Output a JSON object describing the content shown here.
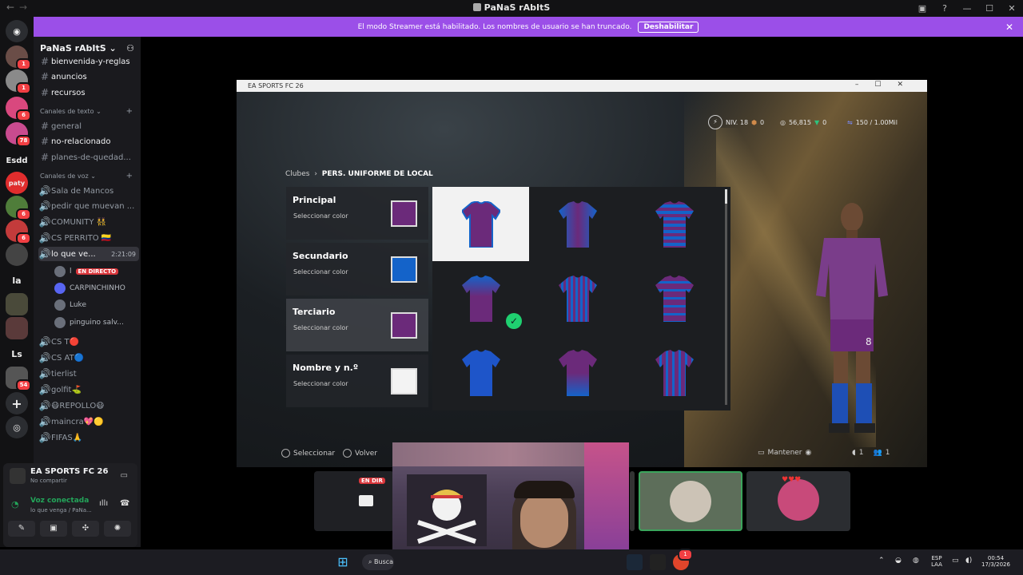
{
  "window": {
    "title": "PaNaS rAbItS"
  },
  "streamer_banner": {
    "message": "El modo Streamer está habilitado. Los nombres de usuario se han truncado.",
    "button": "Deshabilitar"
  },
  "rail": {
    "labels": {
      "esdd": "Esdd",
      "la": "la",
      "ls": "Ls",
      "paty": "paty"
    },
    "badges": [
      "1",
      "1",
      "6",
      "78",
      "6",
      "6",
      "54"
    ]
  },
  "sidebar": {
    "guild_name": "PaNaS rAbItS",
    "top_channels": [
      "bienvenida-y-reglas",
      "anuncios",
      "recursos"
    ],
    "text_category": "Canales de texto",
    "text_channels": [
      "general",
      "no-relacionado",
      "planes-de-quedad..."
    ],
    "voice_category": "Canales de voz",
    "voice_channels": [
      "Sala de Mancos",
      "pedir que muevan ...",
      "COMUNITY 👯",
      "CS PERRITO 🇨🇴",
      "lo que ve...",
      "CS T🔴",
      "CS AT🔵",
      "tierlist",
      "golfit⛳",
      "😷REPOLLO😷",
      "maincra💖🟡",
      "FIFAS🙏"
    ],
    "active_timer": "2:21:09",
    "voice_users": [
      {
        "name": "l",
        "badge": "EN DIRECTO"
      },
      {
        "name": "CARPINCHINHO"
      },
      {
        "name": "Luke"
      },
      {
        "name": "pinguino salv..."
      }
    ]
  },
  "activity": {
    "game": "EA SPORTS FC 26",
    "status": "No compartir",
    "voice_title": "Voz conectada",
    "voice_sub": "lo que venga / PaNa..."
  },
  "game": {
    "window_title": "EA SPORTS FC 26",
    "hud": {
      "level": "NIV. 18",
      "v1": "0",
      "coins": "56,815",
      "v2": "0",
      "points": "150 / 1.00Mil"
    },
    "breadcrumb_root": "Clubes",
    "breadcrumb_current": "PERS. UNIFORME DE LOCAL",
    "options": [
      {
        "title": "Principal",
        "sub": "Seleccionar color",
        "color": "#6b2a7a"
      },
      {
        "title": "Secundario",
        "sub": "Seleccionar color",
        "color": "#1463c9"
      },
      {
        "title": "Terciario",
        "sub": "Seleccionar color",
        "color": "#6b2a7a"
      },
      {
        "title": "Nombre y n.º",
        "sub": "Seleccionar color",
        "color": "#f3f3f3"
      }
    ],
    "hints": {
      "select": "Seleccionar",
      "back": "Volver",
      "hold": "Mantener"
    },
    "right_counts": [
      "1",
      "1"
    ],
    "shirt_number": "8"
  },
  "stream_tiles": {
    "live": "EN DIR"
  },
  "taskbar": {
    "search": "Busca",
    "lang_1": "ESP",
    "lang_2": "LAA",
    "time": "00:54",
    "date": "17/3/2026",
    "badge": "1"
  }
}
